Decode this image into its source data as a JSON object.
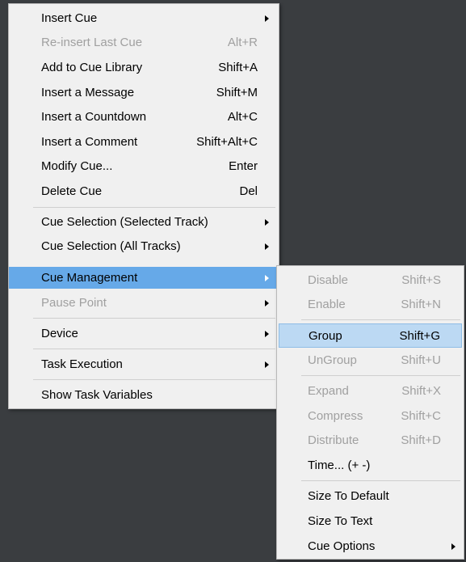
{
  "main_menu": {
    "items": [
      {
        "label": "Insert Cue",
        "shortcut": "",
        "submenu": true,
        "disabled": false
      },
      {
        "label": "Re-insert Last Cue",
        "shortcut": "Alt+R",
        "submenu": false,
        "disabled": true
      },
      {
        "label": "Add to Cue Library",
        "shortcut": "Shift+A",
        "submenu": false,
        "disabled": false
      },
      {
        "label": "Insert a Message",
        "shortcut": "Shift+M",
        "submenu": false,
        "disabled": false
      },
      {
        "label": "Insert a Countdown",
        "shortcut": "Alt+C",
        "submenu": false,
        "disabled": false
      },
      {
        "label": "Insert a Comment",
        "shortcut": "Shift+Alt+C",
        "submenu": false,
        "disabled": false
      },
      {
        "label": "Modify Cue...",
        "shortcut": "Enter",
        "submenu": false,
        "disabled": false
      },
      {
        "label": "Delete Cue",
        "shortcut": "Del",
        "submenu": false,
        "disabled": false
      },
      {
        "label": "Cue Selection (Selected Track)",
        "shortcut": "",
        "submenu": true,
        "disabled": false
      },
      {
        "label": "Cue Selection (All Tracks)",
        "shortcut": "",
        "submenu": true,
        "disabled": false
      },
      {
        "label": "Cue Management",
        "shortcut": "",
        "submenu": true,
        "disabled": false,
        "highlighted": true
      },
      {
        "label": "Pause Point",
        "shortcut": "",
        "submenu": true,
        "disabled": true
      },
      {
        "label": "Device",
        "shortcut": "",
        "submenu": true,
        "disabled": false
      },
      {
        "label": "Task Execution",
        "shortcut": "",
        "submenu": true,
        "disabled": false
      },
      {
        "label": "Show Task Variables",
        "shortcut": "",
        "submenu": false,
        "disabled": false
      }
    ]
  },
  "sub_menu": {
    "items": [
      {
        "label": "Disable",
        "shortcut": "Shift+S",
        "disabled": true
      },
      {
        "label": "Enable",
        "shortcut": "Shift+N",
        "disabled": true
      },
      {
        "label": "Group",
        "shortcut": "Shift+G",
        "disabled": false,
        "highlighted": true
      },
      {
        "label": "UnGroup",
        "shortcut": "Shift+U",
        "disabled": true
      },
      {
        "label": "Expand",
        "shortcut": "Shift+X",
        "disabled": true
      },
      {
        "label": "Compress",
        "shortcut": "Shift+C",
        "disabled": true
      },
      {
        "label": "Distribute",
        "shortcut": "Shift+D",
        "disabled": true
      },
      {
        "label": "Time... (+ -)",
        "shortcut": "",
        "disabled": false
      },
      {
        "label": "Size To Default",
        "shortcut": "",
        "disabled": false
      },
      {
        "label": "Size To Text",
        "shortcut": "",
        "disabled": false
      },
      {
        "label": "Cue Options",
        "shortcut": "",
        "disabled": false,
        "submenu": true
      }
    ]
  },
  "colors": {
    "highlight_blue": "#66a9e8",
    "highlight_light": "#bcd9f3",
    "menu_bg": "#f0f0f0",
    "disabled_text": "#a0a0a0",
    "background": "#3a3d40"
  }
}
